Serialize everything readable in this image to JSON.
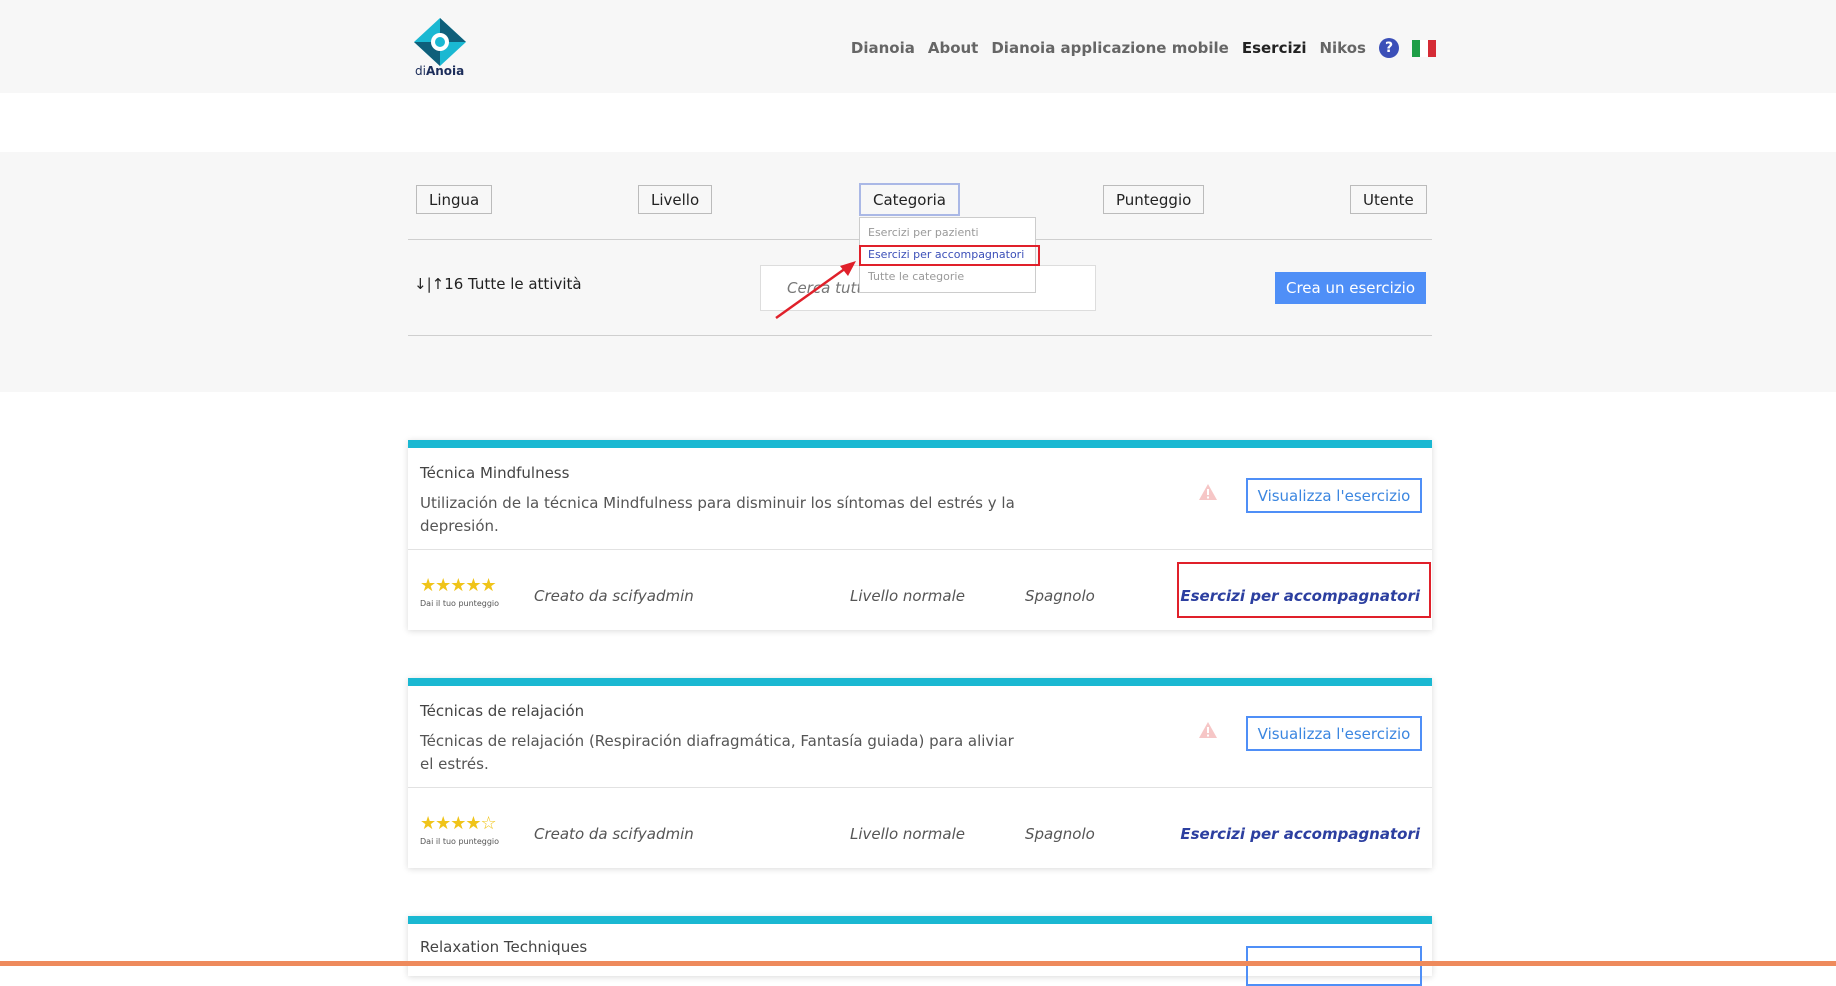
{
  "header": {
    "logo_text_pre": "di",
    "logo_text_bold": "Anoia",
    "nav": [
      "Dianoia",
      "About",
      "Dianoia applicazione mobile",
      "Esercizi",
      "Nikos"
    ],
    "active_nav": "Esercizi",
    "help_glyph": "?",
    "flag_colors": [
      "#1e9e46",
      "#ffffff",
      "#d52b35"
    ]
  },
  "filters": {
    "lingua": "Lingua",
    "livello": "Livello",
    "categoria": "Categoria",
    "punteggio": "Punteggio",
    "utente": "Utente"
  },
  "category_dropdown": {
    "options": [
      "Esercizi per pazienti",
      "Esercizi per accompagnatori",
      "Tutte le categorie"
    ],
    "selected": "Esercizi per accompagnatori"
  },
  "toolbar": {
    "sort_label": "↓|↑16 Tutte le attività",
    "search_placeholder": "Cerca tutte le vo.",
    "create_label": "Crea un esercizio"
  },
  "cards": [
    {
      "title": "Técnica Mindfulness",
      "description": "Utilización de la técnica Mindfulness para disminuir los síntomas del estrés y la depresión.",
      "view_label": "Visualizza l'esercizio",
      "stars": "★★★★★",
      "rating": 5,
      "rate_hint": "Dai il tuo punteggio",
      "creator": "Creato da scifyadmin",
      "level": "Livello normale",
      "language": "Spagnolo",
      "category": "Esercizi per accompagnatori"
    },
    {
      "title": "Técnicas de relajación",
      "description": "Técnicas de relajación (Respiración diafragmática, Fantasía guiada) para aliviar el estrés.",
      "view_label": "Visualizza l'esercizio",
      "stars": "★★★★☆",
      "rating": 4,
      "rate_hint": "Dai il tuo punteggio",
      "creator": "Creato da scifyadmin",
      "level": "Livello normale",
      "language": "Spagnolo",
      "category": "Esercizi per accompagnatori"
    },
    {
      "title": "Relaxation Techniques"
    }
  ],
  "colors": {
    "accent_bar": "#1ab8d2",
    "primary_button": "#4f8ff7",
    "category_text": "#2c3fa0",
    "annotation_red": "#e0202a",
    "bottom_line": "#ee8a5c"
  }
}
